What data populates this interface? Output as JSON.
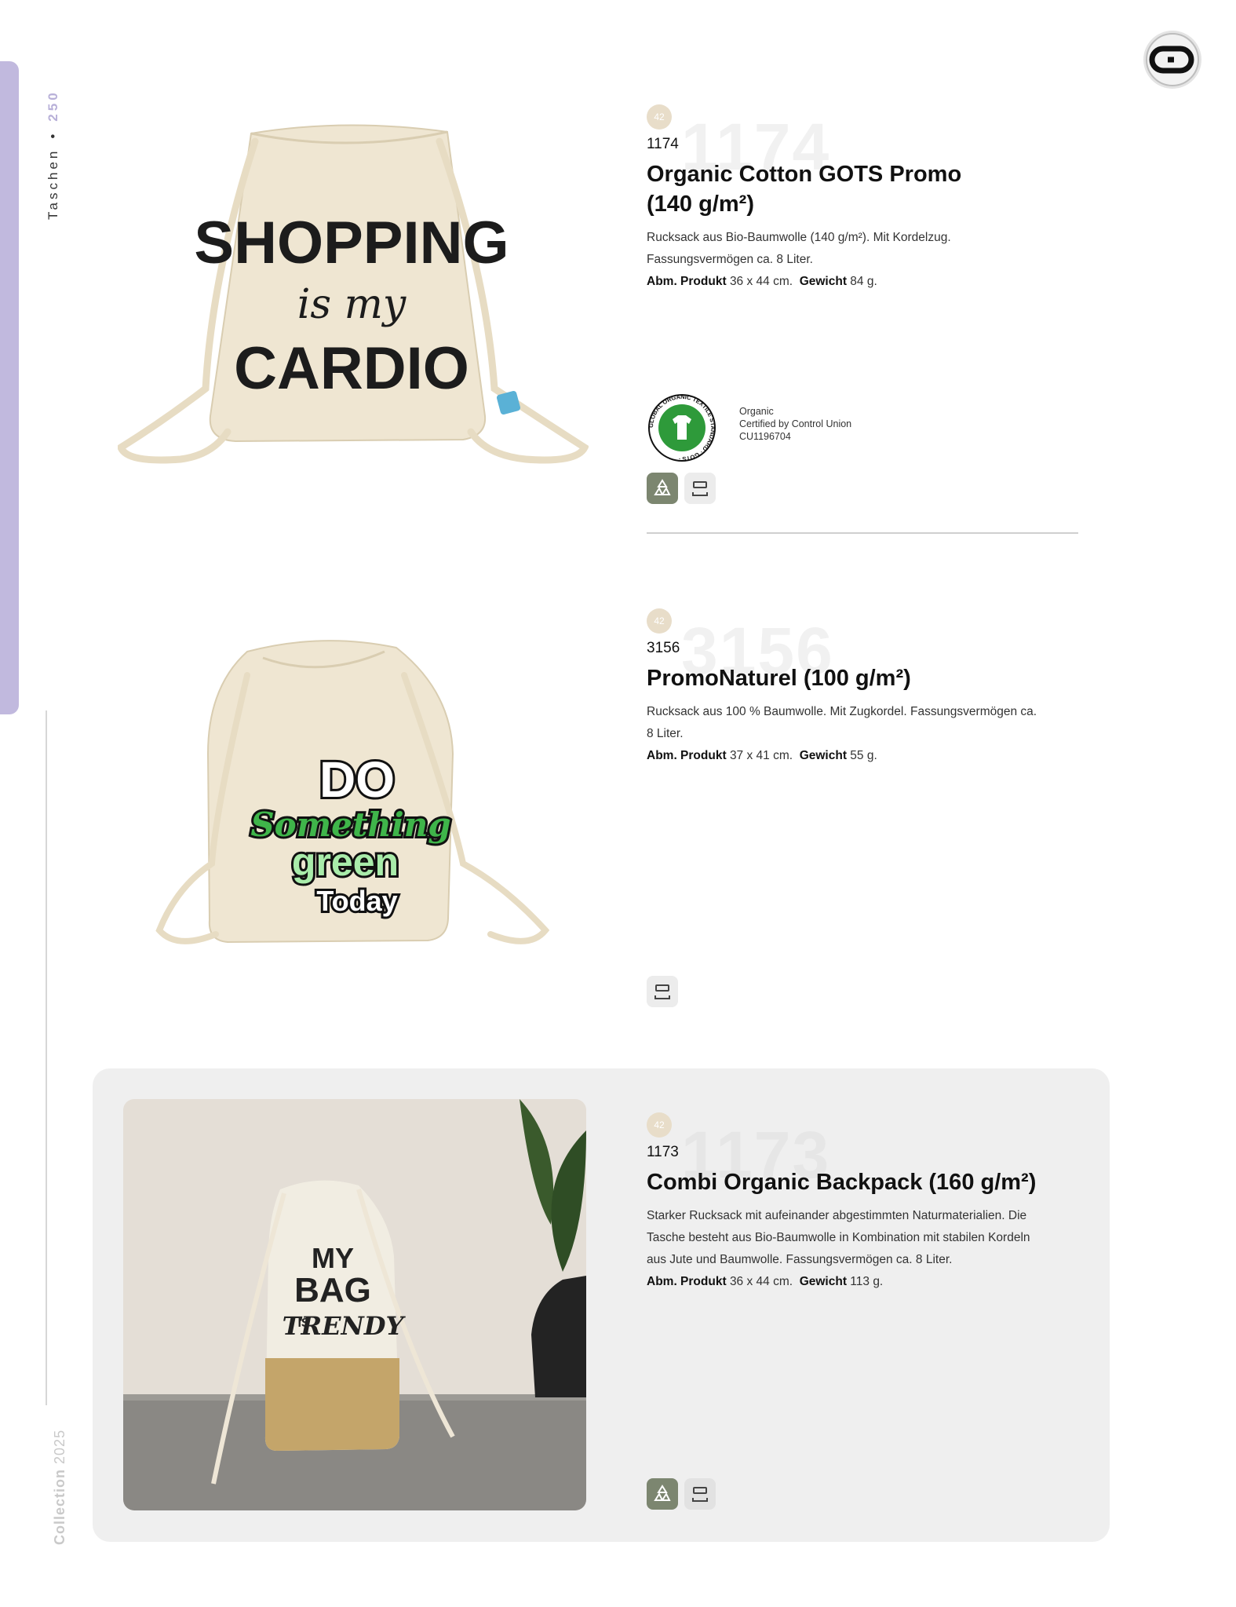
{
  "sidebar": {
    "section": "Taschen",
    "page_number": "250",
    "collection_word": "Collection",
    "collection_year": "2025"
  },
  "products": [
    {
      "badge": "42",
      "code": "1174",
      "ghost": "1174",
      "title_line1": "Organic Cotton GOTS Promo",
      "title_line2": "(140 g/m²)",
      "desc_line1": "Rucksack aus Bio-Baumwolle (140 g/m²). Mit Kordelzug.",
      "desc_line2": "Fassungsvermögen ca. 8 Liter.",
      "dims_label": "Abm. Produkt",
      "dims_value": "36 x 44 cm.",
      "weight_label": "Gewicht",
      "weight_value": "84 g.",
      "print_line1": "SHOPPING",
      "print_line2": "is my",
      "print_line3": "CARDIO",
      "cert_line1": "Organic",
      "cert_line2": "Certified by Control Union",
      "cert_line3": "CU1196704",
      "gots_ring_text": "GLOBAL ORGANIC TEXTILE STANDARD · GOTS ·",
      "icons": [
        "recycle-icon",
        "print-icon"
      ]
    },
    {
      "badge": "42",
      "code": "3156",
      "ghost": "3156",
      "title_line1": "PromoNaturel (100 g/m²)",
      "desc_line1": "Rucksack aus 100 % Baumwolle. Mit Zugkordel. Fassungsvermögen ca.",
      "desc_line2": "8 Liter.",
      "dims_label": "Abm. Produkt",
      "dims_value": "37 x 41 cm.",
      "weight_label": "Gewicht",
      "weight_value": "55 g.",
      "print_line1": "DO",
      "print_line2": "Something",
      "print_line3": "green",
      "print_line4": "Today",
      "icons": [
        "print-icon"
      ]
    },
    {
      "badge": "42",
      "code": "1173",
      "ghost": "1173",
      "title_line1": "Combi Organic Backpack (160 g/m²)",
      "desc_line1": "Starker Rucksack mit aufeinander abgestimmten Naturmaterialien. Die",
      "desc_line2": "Tasche besteht aus Bio-Baumwolle in Kombination mit stabilen Kordeln",
      "desc_line3": "aus Jute und Baumwolle. Fassungsvermögen ca. 8 Liter.",
      "dims_label": "Abm. Produkt",
      "dims_value": "36 x 44 cm.",
      "weight_label": "Gewicht",
      "weight_value": "113 g.",
      "print_line1": "MY",
      "print_line2": "BAG",
      "print_line3": "IS",
      "print_line4": "TRENDY",
      "icons": [
        "recycle-icon",
        "print-icon"
      ]
    }
  ],
  "colors": {
    "sidebar_accent": "#c1b9de",
    "badge": "#e8ddc9",
    "eco_tile": "#7c8670",
    "panel": "#efefef",
    "cotton": "#efe6d2",
    "gots_green": "#2e9a3a"
  }
}
